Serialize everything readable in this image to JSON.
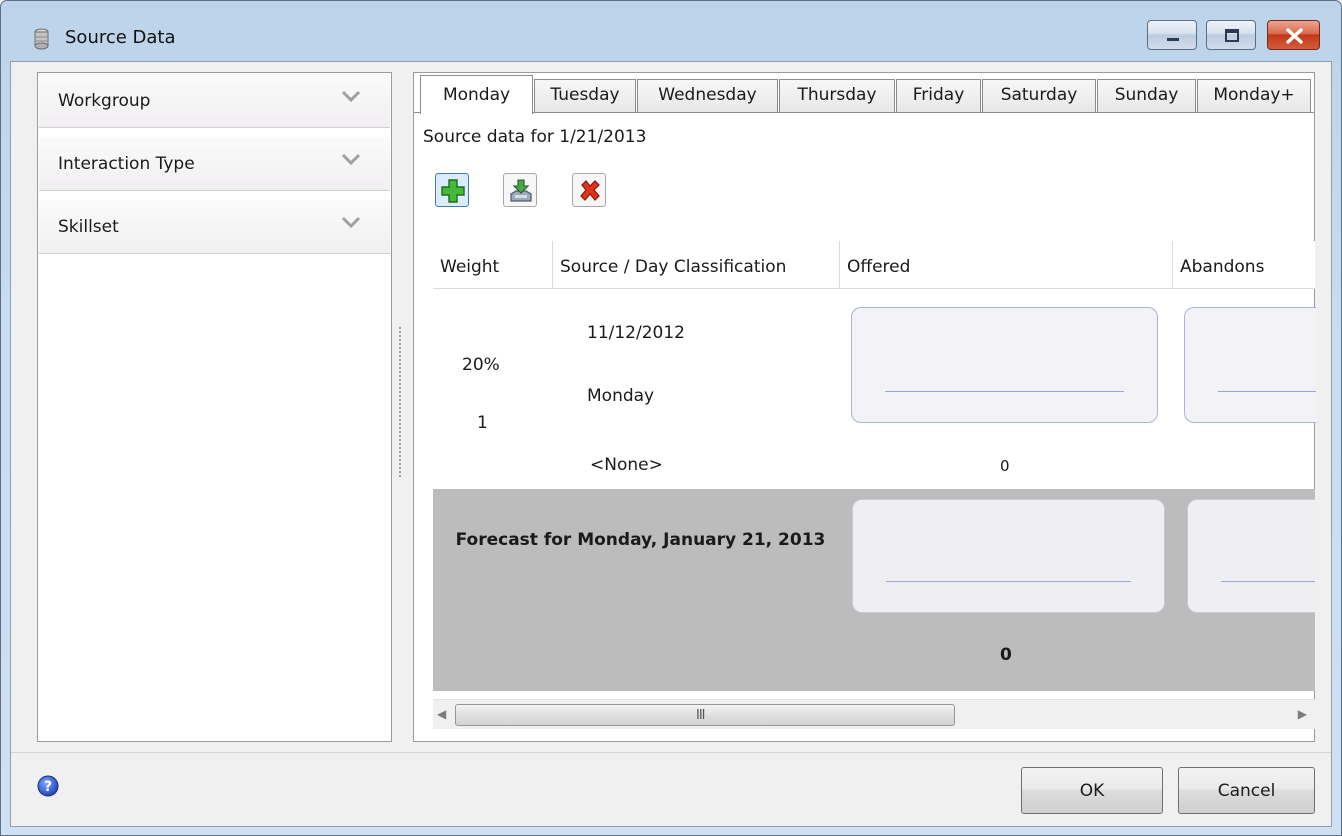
{
  "window": {
    "title": "Source Data"
  },
  "sidebar": {
    "items": [
      {
        "label": "Workgroup"
      },
      {
        "label": "Interaction Type"
      },
      {
        "label": "Skillset"
      }
    ]
  },
  "tabs": [
    {
      "label": "Monday",
      "active": true
    },
    {
      "label": "Tuesday"
    },
    {
      "label": "Wednesday"
    },
    {
      "label": "Thursday"
    },
    {
      "label": "Friday"
    },
    {
      "label": "Saturday"
    },
    {
      "label": "Sunday"
    },
    {
      "label": "Monday+"
    }
  ],
  "main": {
    "source_date_text": "Source data for 1/21/2013",
    "toolbar": {
      "add_icon": "add-icon",
      "import_icon": "import-icon",
      "delete_icon": "delete-icon"
    },
    "columns": [
      {
        "label": "Weight"
      },
      {
        "label": "Source / Day Classification"
      },
      {
        "label": "Offered"
      },
      {
        "label": "Abandons"
      }
    ],
    "source_row": {
      "weight": "20%",
      "rank": "1",
      "date": "11/12/2012",
      "day": "Monday",
      "classification": "<None>",
      "offered": "0"
    },
    "forecast_row": {
      "title": "Forecast for Monday, January 21, 2013",
      "offered": "0"
    },
    "scrollbar_grip": "III"
  },
  "footer": {
    "ok_label": "OK",
    "cancel_label": "Cancel"
  }
}
